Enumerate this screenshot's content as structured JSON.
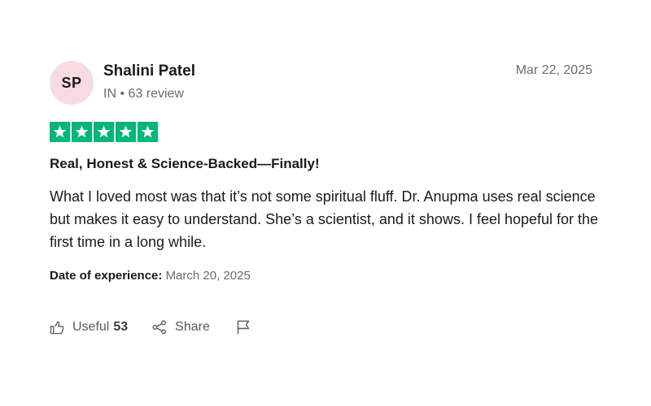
{
  "reviewer": {
    "initials": "SP",
    "name": "Shalini Patel",
    "meta": "IN • 63 review",
    "avatar_color": "#f8dbe2"
  },
  "review": {
    "date": "Mar 22, 2025",
    "rating": 5,
    "star_color": "#00b67a",
    "title": "Real, Honest & Science-Backed—Finally!",
    "body": "What I loved most was that it’s not some spiritual fluff. Dr. Anupma uses real science but makes it easy to understand. She’s a scientist, and it shows. I feel hopeful for the first time in a long while.",
    "experience_label": "Date of experience:",
    "experience_date": "March 20, 2025"
  },
  "actions": {
    "useful_label": "Useful",
    "useful_count": "53",
    "share_label": "Share",
    "icons": [
      "thumbs-up-icon",
      "share-icon",
      "flag-icon"
    ]
  }
}
